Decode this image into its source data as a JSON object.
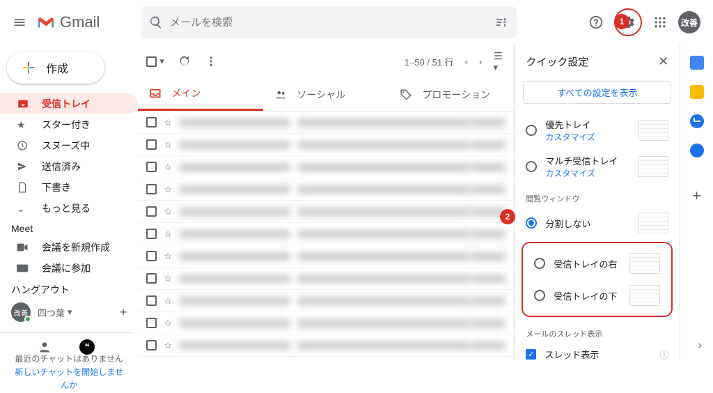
{
  "header": {
    "product": "Gmail",
    "search_placeholder": "メールを検索",
    "avatar_label": "改善"
  },
  "compose_label": "作成",
  "nav": {
    "inbox": "受信トレイ",
    "starred": "スター付き",
    "snoozed": "スヌーズ中",
    "sent": "送信済み",
    "drafts": "下書き",
    "more": "もっと見る"
  },
  "meet": {
    "title": "Meet",
    "new": "会議を新規作成",
    "join": "会議に参加"
  },
  "hangout": {
    "title": "ハングアウト",
    "name": "四つ葉",
    "empty1": "最近のチャットはありません",
    "empty2": "新しいチャットを開始しませんか"
  },
  "toolbar": {
    "range": "1–50 / 51 行"
  },
  "tabs": {
    "main": "メイン",
    "social": "ソーシャル",
    "promo": "プロモーション"
  },
  "quick": {
    "title": "クイック設定",
    "all_settings": "すべての設定を表示",
    "priority": "優先トレイ",
    "customize": "カスタマイズ",
    "multi": "マルチ受信トレイ",
    "reading_pane": "閲覧ウィンドウ",
    "no_split": "分割しない",
    "right": "受信トレイの右",
    "below": "受信トレイの下",
    "thread_section": "メールのスレッド表示",
    "thread_on": "スレッド表示"
  },
  "annotations": {
    "a1": "1",
    "a2": "2"
  }
}
